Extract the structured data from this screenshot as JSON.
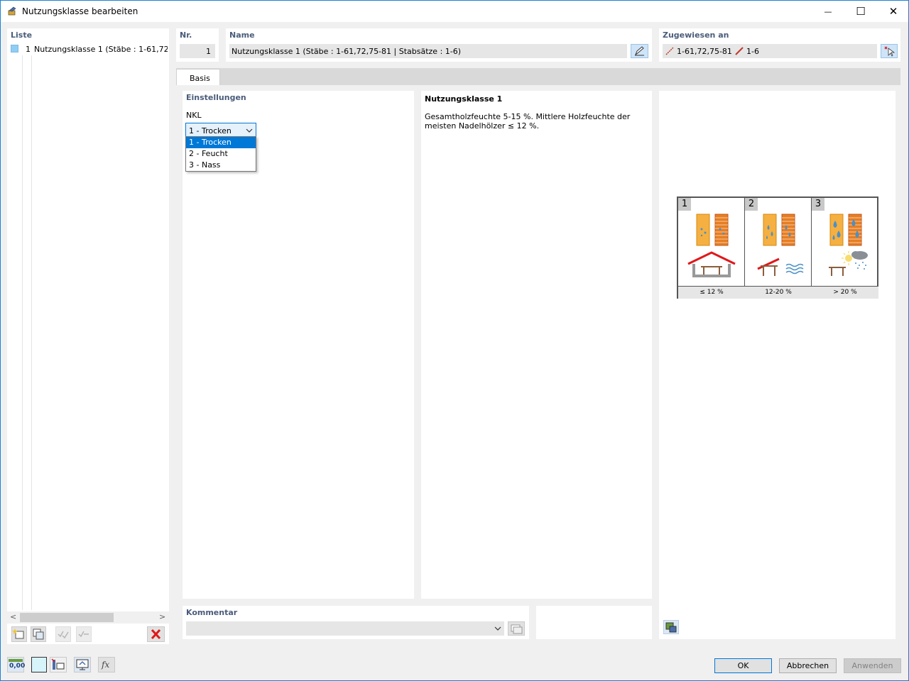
{
  "window": {
    "title": "Nutzungsklasse bearbeiten",
    "minimize": "—",
    "maximize": "☐",
    "close": "✕"
  },
  "list": {
    "header": "Liste",
    "items": [
      {
        "number": "1",
        "label": "Nutzungsklasse 1 (Stäbe : 1-61,72,75-"
      }
    ],
    "scroll_left": "<",
    "scroll_right": ">"
  },
  "nr": {
    "header": "Nr.",
    "value": "1"
  },
  "name": {
    "header": "Name",
    "value": "Nutzungsklasse 1 (Stäbe : 1-61,72,75-81 | Stabsätze : 1-6)"
  },
  "assigned": {
    "header": "Zugewiesen an",
    "members": "1-61,72,75-81",
    "member_sets": "1-6"
  },
  "tabs": [
    {
      "label": "Basis"
    }
  ],
  "settings": {
    "header": "Einstellungen",
    "nkl_label": "NKL",
    "nkl_selected": "1 - Trocken",
    "nkl_options": [
      "1 - Trocken",
      "2 - Feucht",
      "3 - Nass"
    ]
  },
  "info": {
    "title": "Nutzungsklasse 1",
    "text": "Gesamtholzfeuchte 5-15 %. Mittlere Holzfeuchte der meisten Nadelhölzer ≤ 12 %."
  },
  "figure": {
    "panels": [
      {
        "number": "1",
        "label": "≤ 12 %"
      },
      {
        "number": "2",
        "label": "12-20 %"
      },
      {
        "number": "3",
        "label": "> 20 %"
      }
    ]
  },
  "comment": {
    "header": "Kommentar",
    "value": ""
  },
  "buttons": {
    "ok": "OK",
    "cancel": "Abbrechen",
    "apply": "Anwenden"
  },
  "bottom_icons": {
    "units_text": "0,00",
    "function_text": "fx"
  },
  "colors": {
    "accent": "#1883d7",
    "header_text": "#4a5c7a",
    "selection": "#0078d7",
    "wood": "#f5b041",
    "wood_dark": "#e67e22",
    "roof": "#e0181b"
  }
}
